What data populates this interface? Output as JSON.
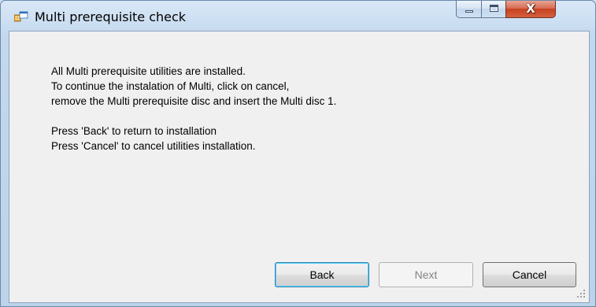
{
  "window": {
    "title": "Multi prerequisite check",
    "close_glyph": "X",
    "icon": "app-window-icon"
  },
  "message": {
    "lines": [
      "All Multi prerequisite utilities are installed.",
      "To continue the instalation of Multi, click on cancel,",
      "remove the Multi prerequisite disc and insert the Multi disc 1.",
      "",
      "Press 'Back' to return to installation",
      "Press 'Cancel' to cancel utilities installation."
    ]
  },
  "buttons": {
    "back": "Back",
    "next": "Next",
    "cancel": "Cancel"
  },
  "colors": {
    "frame": "#bcd3ea",
    "client": "#f0f0f0",
    "close_button": "#c7411f",
    "default_button_border": "#3c7fb1"
  }
}
